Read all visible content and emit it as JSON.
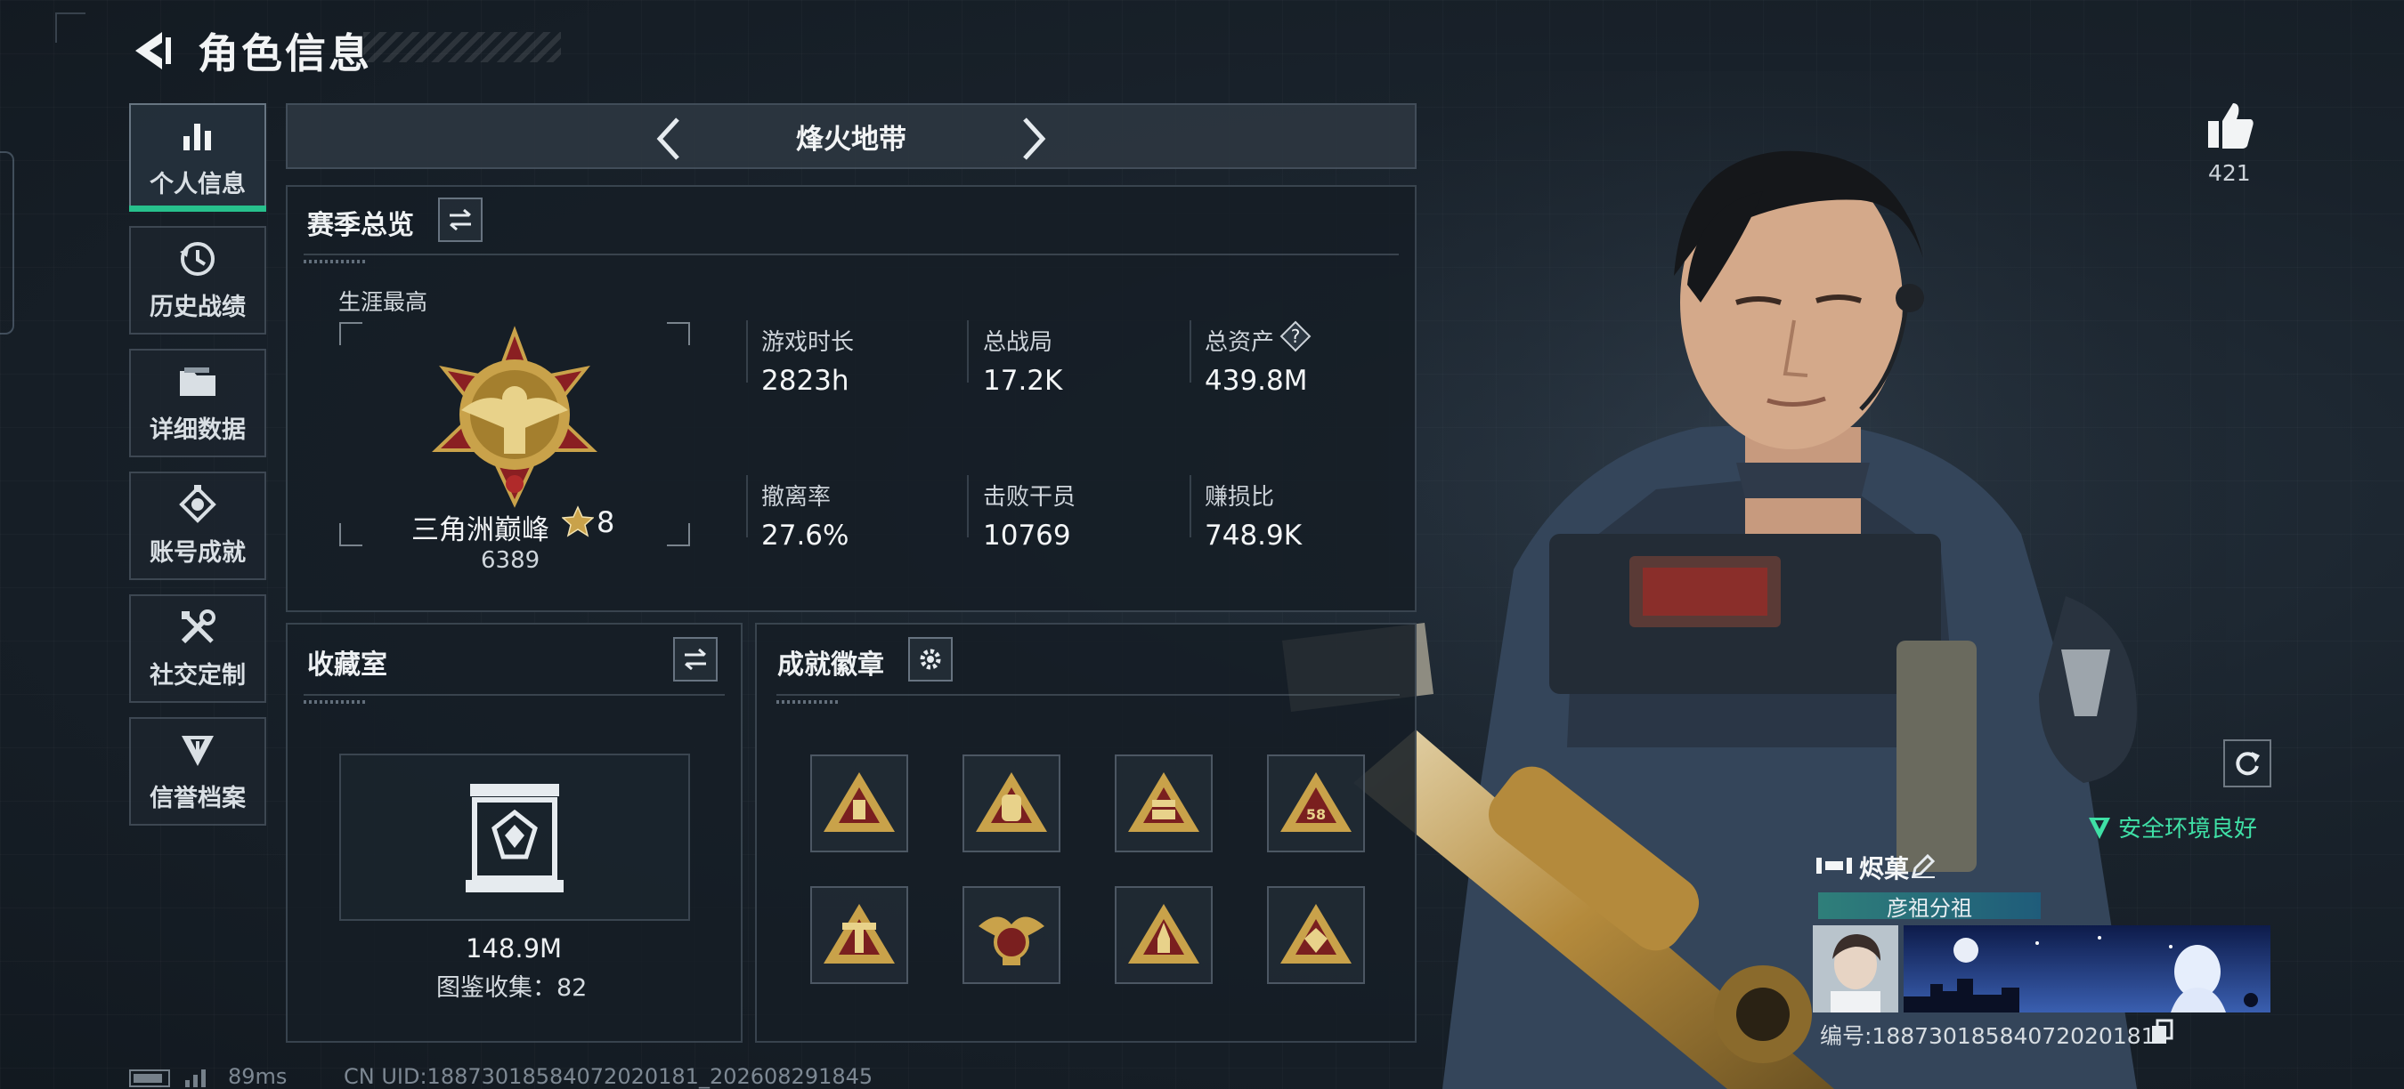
{
  "header": {
    "title": "角色信息"
  },
  "sidebar": {
    "items": [
      {
        "label": "个人信息",
        "icon": "bar-chart-icon",
        "active": true
      },
      {
        "label": "历史战绩",
        "icon": "history-clock-icon",
        "active": false
      },
      {
        "label": "详细数据",
        "icon": "folder-icon",
        "active": false
      },
      {
        "label": "账号成就",
        "icon": "achievement-medal-icon",
        "active": false
      },
      {
        "label": "社交定制",
        "icon": "wrench-screwdriver-icon",
        "active": false
      },
      {
        "label": "信誉档案",
        "icon": "shield-emblem-icon",
        "active": false
      }
    ]
  },
  "mode": {
    "title": "烽火地带"
  },
  "season": {
    "title": "赛季总览",
    "career_label": "生涯最高",
    "rank_name": "三角洲巅峰",
    "rank_level": "8",
    "rank_points": "6389",
    "stats": [
      {
        "label": "游戏时长",
        "value": "2823h"
      },
      {
        "label": "总战局",
        "value": "17.2K"
      },
      {
        "label": "总资产",
        "value": "439.8M"
      },
      {
        "label": "撤离率",
        "value": "27.6%"
      },
      {
        "label": "击败干员",
        "value": "10769"
      },
      {
        "label": "赚损比",
        "value": "748.9K"
      }
    ]
  },
  "collection": {
    "title": "收藏室",
    "value": "148.9M",
    "count_text": "图鉴收集：82"
  },
  "badges": {
    "title": "成就徽章",
    "slots": [
      {
        "icon": "badge-triangle-icon"
      },
      {
        "icon": "badge-backpack-icon"
      },
      {
        "icon": "badge-crate-icon"
      },
      {
        "icon": "badge-58-icon",
        "text": "58"
      },
      {
        "icon": "badge-tower-icon"
      },
      {
        "icon": "badge-eagle-icon"
      },
      {
        "icon": "badge-rocket-icon"
      },
      {
        "icon": "badge-diamond-icon"
      }
    ]
  },
  "footer": {
    "ping": "89ms",
    "uid": "CN UID:18873018584072020181_202608291845"
  },
  "likes": {
    "count": "421"
  },
  "status": {
    "safety_text": "安全环境良好"
  },
  "player": {
    "name": "烬菓",
    "club": "彦祖分祖",
    "id_text": "编号:18873018584072020181"
  },
  "colors": {
    "accent_green": "#27c08c",
    "safety_green": "#3fe0a6",
    "rank_gold": "#c9a24a"
  }
}
